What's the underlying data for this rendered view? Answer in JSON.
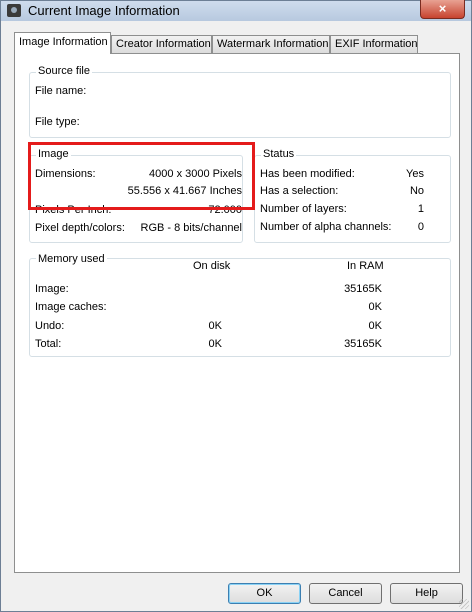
{
  "window": {
    "title": "Current Image Information",
    "close_label": "×"
  },
  "tabs": [
    {
      "label": "Image Information"
    },
    {
      "label": "Creator Information"
    },
    {
      "label": "Watermark Information"
    },
    {
      "label": "EXIF Information"
    }
  ],
  "source_file": {
    "title": "Source file",
    "file_name_label": "File name:",
    "file_type_label": "File type:"
  },
  "image": {
    "title": "Image",
    "dimensions_label": "Dimensions:",
    "dimensions_pixels": "4000 x 3000 Pixels",
    "dimensions_inches": "55.556 x 41.667 Inches",
    "ppi_label": "Pixels Per Inch:",
    "ppi_value": "72.000",
    "depth_label": "Pixel depth/colors:",
    "depth_value": "RGB - 8 bits/channel"
  },
  "status": {
    "title": "Status",
    "rows": [
      {
        "label": "Has been modified:",
        "value": "Yes"
      },
      {
        "label": "Has a selection:",
        "value": "No"
      },
      {
        "label": "Number of layers:",
        "value": "1"
      },
      {
        "label": "Number of alpha channels:",
        "value": "0"
      }
    ]
  },
  "memory": {
    "title": "Memory used",
    "col_disk": "On disk",
    "col_ram": "In RAM",
    "rows": [
      {
        "label": "Image:",
        "disk": "",
        "ram": "35165K"
      },
      {
        "label": "Image caches:",
        "disk": "",
        "ram": "0K"
      },
      {
        "label": "Undo:",
        "disk": "0K",
        "ram": "0K"
      },
      {
        "label": "Total:",
        "disk": "0K",
        "ram": "35165K"
      }
    ]
  },
  "buttons": {
    "ok": "OK",
    "cancel": "Cancel",
    "help": "Help"
  },
  "colors": {
    "highlight": "#e41b1b"
  }
}
